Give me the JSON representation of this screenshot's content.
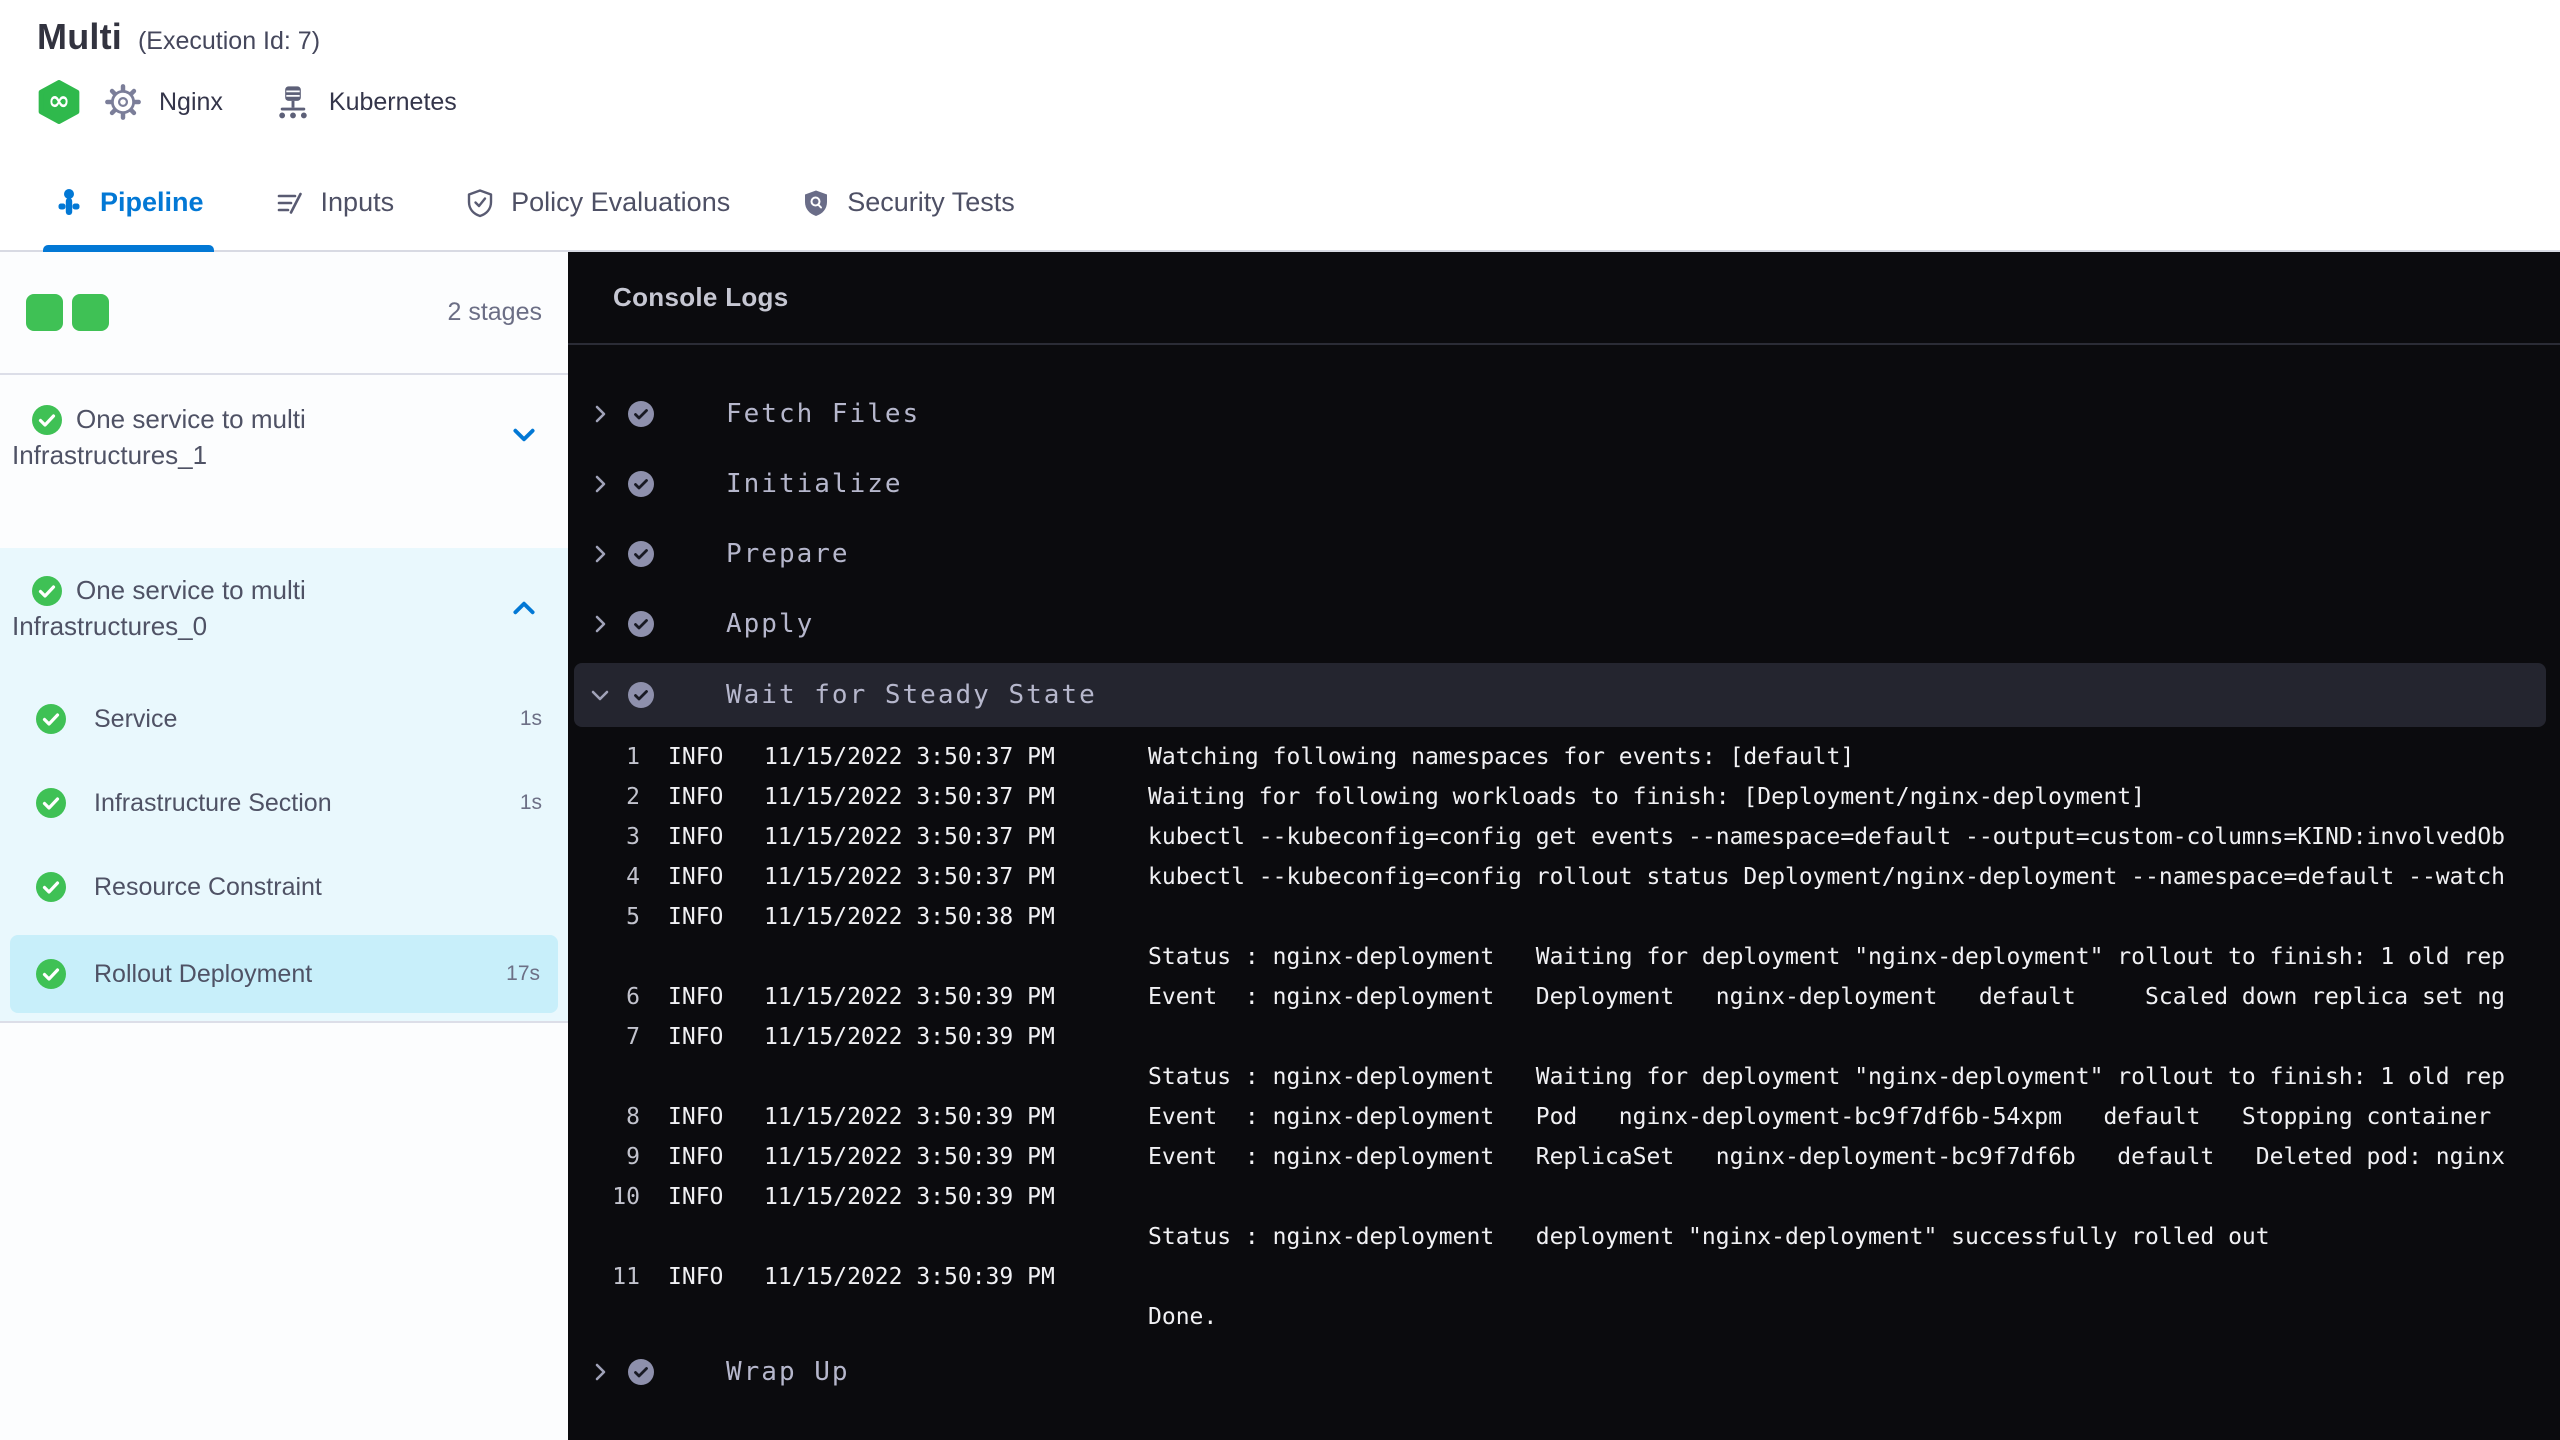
{
  "header": {
    "title": "Multi",
    "execution_id": "(Execution Id: 7)",
    "service": {
      "label": "Nginx"
    },
    "environment": {
      "label": "Kubernetes"
    }
  },
  "tabs": [
    {
      "label": "Pipeline"
    },
    {
      "label": "Inputs"
    },
    {
      "label": "Policy Evaluations"
    },
    {
      "label": "Security Tests"
    }
  ],
  "sidebar": {
    "stage_count": "2 stages",
    "stages": [
      {
        "name": "One service to multi Infrastructures_1"
      },
      {
        "name": "One service to multi Infrastructures_0",
        "steps": [
          {
            "label": "Service",
            "duration": "1s"
          },
          {
            "label": "Infrastructure Section",
            "duration": "1s"
          },
          {
            "label": "Resource Constraint",
            "duration": ""
          },
          {
            "label": "Rollout Deployment",
            "duration": "17s"
          }
        ]
      }
    ]
  },
  "console": {
    "title": "Console Logs",
    "steps": [
      {
        "label": "Fetch Files"
      },
      {
        "label": "Initialize"
      },
      {
        "label": "Prepare"
      },
      {
        "label": "Apply"
      }
    ],
    "expanded_step": "Wait for Steady State",
    "final_step": "Wrap Up",
    "logs": [
      {
        "num": "1",
        "level": "INFO",
        "time": "11/15/2022 3:50:37 PM",
        "message": "Watching following namespaces for events: [default]"
      },
      {
        "num": "2",
        "level": "INFO",
        "time": "11/15/2022 3:50:37 PM",
        "message": "Waiting for following workloads to finish: [Deployment/nginx-deployment]"
      },
      {
        "num": "3",
        "level": "INFO",
        "time": "11/15/2022 3:50:37 PM",
        "message": "kubectl --kubeconfig=config get events --namespace=default --output=custom-columns=KIND:involvedOb"
      },
      {
        "num": "4",
        "level": "INFO",
        "time": "11/15/2022 3:50:37 PM",
        "message": "kubectl --kubeconfig=config rollout status Deployment/nginx-deployment --namespace=default --watch"
      },
      {
        "num": "5",
        "level": "INFO",
        "time": "11/15/2022 3:50:38 PM",
        "message": ""
      },
      {
        "num": "",
        "level": "",
        "time": "",
        "message": "Status : nginx-deployment   Waiting for deployment \"nginx-deployment\" rollout to finish: 1 old rep"
      },
      {
        "num": "6",
        "level": "INFO",
        "time": "11/15/2022 3:50:39 PM",
        "message": "Event  : nginx-deployment   Deployment   nginx-deployment   default     Scaled down replica set ng"
      },
      {
        "num": "7",
        "level": "INFO",
        "time": "11/15/2022 3:50:39 PM",
        "message": ""
      },
      {
        "num": "",
        "level": "",
        "time": "",
        "message": "Status : nginx-deployment   Waiting for deployment \"nginx-deployment\" rollout to finish: 1 old rep"
      },
      {
        "num": "8",
        "level": "INFO",
        "time": "11/15/2022 3:50:39 PM",
        "message": "Event  : nginx-deployment   Pod   nginx-deployment-bc9f7df6b-54xpm   default   Stopping container"
      },
      {
        "num": "9",
        "level": "INFO",
        "time": "11/15/2022 3:50:39 PM",
        "message": "Event  : nginx-deployment   ReplicaSet   nginx-deployment-bc9f7df6b   default   Deleted pod: nginx"
      },
      {
        "num": "10",
        "level": "INFO",
        "time": "11/15/2022 3:50:39 PM",
        "message": ""
      },
      {
        "num": "",
        "level": "",
        "time": "",
        "message": "Status : nginx-deployment   deployment \"nginx-deployment\" successfully rolled out"
      },
      {
        "num": "11",
        "level": "INFO",
        "time": "11/15/2022 3:50:39 PM",
        "message": ""
      },
      {
        "num": "",
        "level": "",
        "time": "",
        "message": "Done."
      }
    ]
  },
  "colors": {
    "accent_blue": "#0278d5",
    "success_green": "#3fc155",
    "selected_step_bg": "#c8effa",
    "expanded_stage_bg": "#e9f8fd",
    "console_bg": "#0b0b0e",
    "console_highlight_row": "#24252f"
  }
}
